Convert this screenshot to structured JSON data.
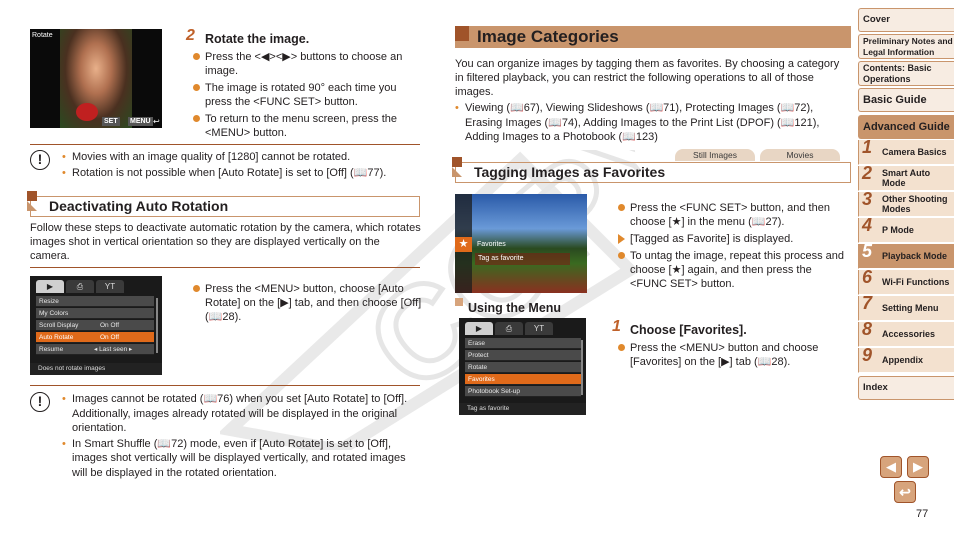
{
  "left": {
    "rotate_screen": {
      "label": "Rotate",
      "footer_set": "SET",
      "footer_menu": "MENU"
    },
    "step2": {
      "num": "2",
      "title": "Rotate the image.",
      "bullets": [
        "Press the <◀><▶> buttons to choose an image.",
        "The image is rotated 90° each time you press the <FUNC SET> button.",
        "To return to the menu screen, press the <MENU> button."
      ]
    },
    "caution1": {
      "icon": "!",
      "items": [
        "Movies with an image quality of [1280] cannot be rotated.",
        "Rotation is not possible when [Auto Rotate] is set to [Off] (📖77)."
      ]
    },
    "section_deactivate": {
      "title": "Deactivating Auto Rotation",
      "body": "Follow these steps to deactivate automatic rotation by the camera, which rotates images shot in vertical orientation so they are displayed vertically on the camera."
    },
    "menu_screen": {
      "tabs": [
        "▶",
        "⎙",
        "YT"
      ],
      "rows": [
        {
          "label": "Resize",
          "value": ""
        },
        {
          "label": "My Colors",
          "value": ""
        },
        {
          "label": "Scroll Display",
          "value": "On  Off"
        },
        {
          "label": "Auto Rotate",
          "value": "On  Off"
        },
        {
          "label": "Resume",
          "value": "◂ Last seen ▸"
        }
      ],
      "selected_index": 3,
      "footer": "Does not rotate images"
    },
    "deactivate_step": "Press the <MENU> button, choose [Auto Rotate] on the [▶] tab, and then choose [Off] (📖28).",
    "caution2": {
      "icon": "!",
      "items": [
        "Images cannot be rotated (📖76) when you set [Auto Rotate] to [Off]. Additionally, images already rotated will be displayed in the original orientation.",
        "In Smart Shuffle (📖72) mode, even if [Auto Rotate] is set to [Off], images shot vertically will be displayed vertically, and rotated images will be displayed in the rotated orientation."
      ]
    }
  },
  "right": {
    "section_title": "Image Categories",
    "intro": "You can organize images by tagging them as favorites. By choosing a category in filtered playback, you can restrict the following operations to all of those images.",
    "operations": "Viewing (📖67), Viewing Slideshows (📖71), Protecting Images (📖72), Erasing Images (📖74), Adding Images to the Print List (DPOF) (📖121), Adding Images to a Photobook (📖123)",
    "mode_tabs": [
      "Still Images",
      "Movies"
    ],
    "subsection_title": "Tagging Images as Favorites",
    "fav_screen": {
      "item_label": "Favorites",
      "item_desc": "Tag as favorite"
    },
    "tag_bullets": [
      {
        "type": "dot",
        "text": "Press the <FUNC SET> button, and then choose [★] in the menu (📖27)."
      },
      {
        "type": "arrow",
        "text": "[Tagged as Favorite] is displayed."
      },
      {
        "type": "dot",
        "text": "To untag the image, repeat this process and choose [★] again, and then press the <FUNC SET> button."
      }
    ],
    "using_menu_title": "Using the Menu",
    "menu_screen": {
      "tabs": [
        "▶",
        "⎙",
        "YT"
      ],
      "rows": [
        "Erase",
        "Protect",
        "Rotate",
        "Favorites",
        "Photobook Set-up"
      ],
      "selected_index": 3,
      "footer": "Tag as favorite"
    },
    "step1": {
      "num": "1",
      "title": "Choose [Favorites].",
      "bullet": "Press the <MENU> button and choose [Favorites] on the [▶] tab (📖28)."
    }
  },
  "nav": {
    "cover": "Cover",
    "prelim": "Preliminary Notes and Legal Information",
    "contents": "Contents: Basic Operations",
    "basic": "Basic Guide",
    "advanced": "Advanced Guide",
    "chapters": [
      {
        "num": "1",
        "label": "Camera Basics"
      },
      {
        "num": "2",
        "label": "Smart Auto Mode"
      },
      {
        "num": "3",
        "label": "Other Shooting Modes"
      },
      {
        "num": "4",
        "label": "P Mode"
      },
      {
        "num": "5",
        "label": "Playback Mode"
      },
      {
        "num": "6",
        "label": "Wi-Fi Functions"
      },
      {
        "num": "7",
        "label": "Setting Menu"
      },
      {
        "num": "8",
        "label": "Accessories"
      },
      {
        "num": "9",
        "label": "Appendix"
      }
    ],
    "active_chapter": "5",
    "index": "Index"
  },
  "footer": {
    "prev_icon": "◀",
    "next_icon": "▶",
    "back_icon": "↩",
    "page_number": "77"
  },
  "watermark": "COPY"
}
